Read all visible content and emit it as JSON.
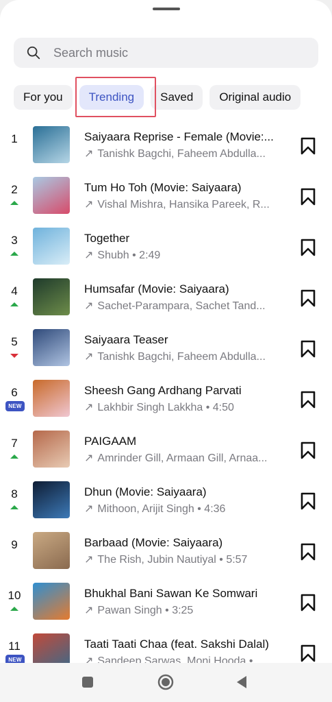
{
  "search": {
    "placeholder": "Search music"
  },
  "tabs": [
    {
      "label": "For you"
    },
    {
      "label": "Trending",
      "active": true
    },
    {
      "label": "Saved"
    },
    {
      "label": "Original audio"
    }
  ],
  "tracks": [
    {
      "rank": "1",
      "title": "Saiyaara Reprise - Female (Movie:...",
      "artists": "Tanishk Bagchi, Faheem Abdulla...",
      "trend": "none",
      "colors": [
        "#2a6f96",
        "#b6d6e6"
      ]
    },
    {
      "rank": "2",
      "title": "Tum Ho Toh (Movie: Saiyaara)",
      "artists": "Vishal Mishra, Hansika Pareek, R...",
      "trend": "up",
      "colors": [
        "#a9c9e3",
        "#d74b6a"
      ]
    },
    {
      "rank": "3",
      "title": "Together",
      "artists": "Shubh • 2:49",
      "trend": "up",
      "colors": [
        "#6fb2dc",
        "#d9edf7"
      ]
    },
    {
      "rank": "4",
      "title": "Humsafar (Movie: Saiyaara)",
      "artists": "Sachet-Parampara, Sachet Tand...",
      "trend": "up",
      "colors": [
        "#1e3a2b",
        "#6e8d4a"
      ]
    },
    {
      "rank": "5",
      "title": "Saiyaara Teaser",
      "artists": "Tanishk Bagchi, Faheem Abdulla...",
      "trend": "down",
      "colors": [
        "#2f4a7a",
        "#b0c4e2"
      ]
    },
    {
      "rank": "6",
      "title": "Sheesh Gang Ardhang Parvati",
      "artists": "Lakhbir Singh Lakkha • 4:50",
      "trend": "new",
      "new_label": "NEW",
      "colors": [
        "#c86a2a",
        "#f0c7d2"
      ]
    },
    {
      "rank": "7",
      "title": "PAIGAAM",
      "artists": "Amrinder Gill, Armaan Gill, Arnaa...",
      "trend": "up",
      "colors": [
        "#b5684a",
        "#e8cbb4"
      ]
    },
    {
      "rank": "8",
      "title": "Dhun (Movie: Saiyaara)",
      "artists": "Mithoon, Arijit Singh • 4:36",
      "trend": "up",
      "colors": [
        "#0e1c33",
        "#3d7ab8"
      ]
    },
    {
      "rank": "9",
      "title": "Barbaad (Movie: Saiyaara)",
      "artists": "The Rish, Jubin Nautiyal • 5:57",
      "trend": "none",
      "colors": [
        "#c9a983",
        "#8a6a4f"
      ]
    },
    {
      "rank": "10",
      "title": "Bhukhal Bani Sawan Ke Somwari",
      "artists": "Pawan Singh • 3:25",
      "trend": "up",
      "colors": [
        "#2f8fd1",
        "#e57b2f"
      ]
    },
    {
      "rank": "11",
      "title": "Taati Taati Chaa (feat. Sakshi Dalal)",
      "artists": "Sandeep Sarwas, Moni Hooda •",
      "trend": "new",
      "new_label": "NEW",
      "colors": [
        "#c14a3a",
        "#3a6a8a"
      ]
    }
  ],
  "theme": {
    "accent": "#3d54c2",
    "accent_bg": "#e3e7fb",
    "up": "#2aa84a",
    "down": "#d9303a",
    "highlight": "#e05060"
  }
}
